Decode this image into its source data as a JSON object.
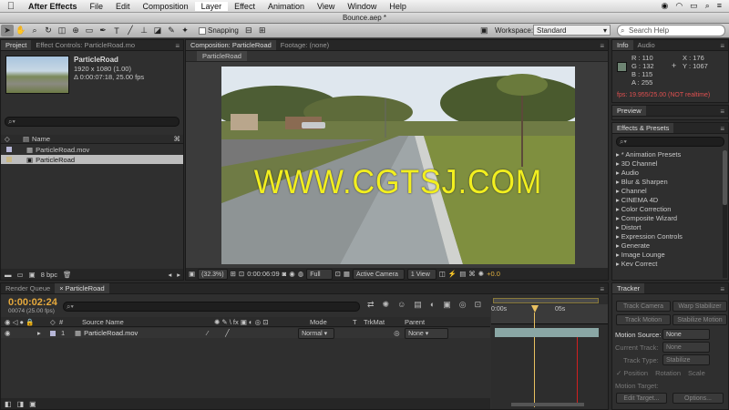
{
  "menubar": {
    "app": "After Effects",
    "items": [
      "File",
      "Edit",
      "Composition",
      "Layer",
      "Effect",
      "Animation",
      "View",
      "Window",
      "Help"
    ],
    "active": "Layer"
  },
  "titlebar": {
    "title": "Bounce.aep *"
  },
  "toolbar": {
    "snapping": "Snapping",
    "workspace_label": "Workspace:",
    "workspace_value": "Standard",
    "search_placeholder": "Search Help"
  },
  "project": {
    "tabs": [
      "Project",
      "Effect Controls: ParticleRoad.mo"
    ],
    "name": "ParticleRoad",
    "info1": "1920 x 1080 (1.00)",
    "info2": "Δ 0:00:07:18, 25.00 fps",
    "col_name": "Name",
    "items": [
      "ParticleRoad.mov",
      "ParticleRoad"
    ],
    "bpc": "8 bpc"
  },
  "comp": {
    "tabs": [
      "Composition: ParticleRoad",
      "Footage: (none)"
    ],
    "subtab": "ParticleRoad",
    "watermark": "WWW.CGTSJ.COM",
    "zoom": "(32.3%)",
    "timecode": "0:00:06:09",
    "resolution": "Full",
    "camera": "Active Camera",
    "view": "1 View",
    "exposure": "+0.0"
  },
  "info": {
    "tabs": [
      "Info",
      "Audio"
    ],
    "r": "R : 110",
    "g": "G : 132",
    "b": "B : 115",
    "a": "A : 255",
    "x": "X : 176",
    "y": "Y : 1067",
    "fps": "fps: 19.955/25.00 (NOT realtime)",
    "swatch": "#6e8473"
  },
  "preview": {
    "tab": "Preview"
  },
  "effects": {
    "tab": "Effects & Presets",
    "items": [
      "* Animation Presets",
      "3D Channel",
      "Audio",
      "Blur & Sharpen",
      "Channel",
      "CINEMA 4D",
      "Color Correction",
      "Composite Wizard",
      "Distort",
      "Expression Controls",
      "Generate",
      "Image Lounge",
      "Kev Correct"
    ]
  },
  "timeline": {
    "tabs": [
      "Render Queue",
      "ParticleRoad"
    ],
    "timecode": "0:00:02:24",
    "frameinfo": "00074 (25.00 fps)",
    "cols": {
      "source": "Source Name",
      "mode": "Mode",
      "t": "T",
      "trkmat": "TrkMat",
      "parent": "Parent"
    },
    "layer": {
      "num": "1",
      "name": "ParticleRoad.mov",
      "mode": "Normal",
      "parent": "None"
    },
    "ruler": [
      "0:00s",
      "05s"
    ],
    "toggle": "Toggle Switches / Modes"
  },
  "tracker": {
    "tab": "Tracker",
    "buttons": [
      "Track Camera",
      "Warp Stabilizer",
      "Track Motion",
      "Stabilize Motion"
    ],
    "motion_source_label": "Motion Source:",
    "motion_source": "None",
    "current_track_label": "Current Track:",
    "current_track": "None",
    "track_type_label": "Track Type:",
    "track_type": "Stabilize",
    "checks": [
      "Position",
      "Rotation",
      "Scale"
    ],
    "motion_target": "Motion Target:",
    "edit_target": "Edit Target...",
    "options": "Options..."
  }
}
